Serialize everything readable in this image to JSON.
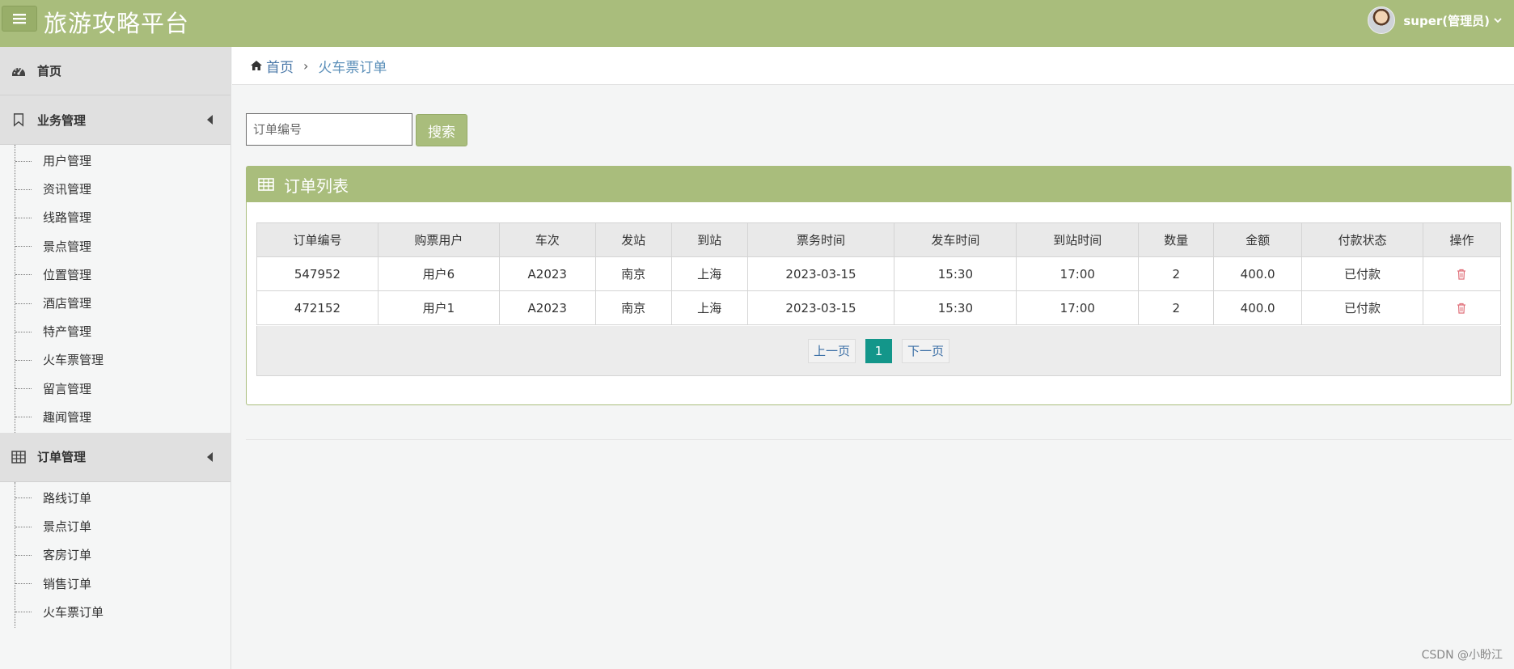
{
  "header": {
    "title": "旅游攻略平台",
    "user": "super(管理员)",
    "accent": "#a9bd7c"
  },
  "sidebar": {
    "home": "首页",
    "groups": [
      {
        "label": "业务管理",
        "items": [
          "用户管理",
          "资讯管理",
          "线路管理",
          "景点管理",
          "位置管理",
          "酒店管理",
          "特产管理",
          "火车票管理",
          "留言管理",
          "趣闻管理"
        ]
      },
      {
        "label": "订单管理",
        "items": [
          "路线订单",
          "景点订单",
          "客房订单",
          "销售订单",
          "火车票订单"
        ]
      }
    ]
  },
  "breadcrumb": {
    "home": "首页",
    "current": "火车票订单"
  },
  "search": {
    "placeholder": "订单编号",
    "button": "搜索"
  },
  "panel": {
    "title": "订单列表"
  },
  "table": {
    "columns": [
      "订单编号",
      "购票用户",
      "车次",
      "发站",
      "到站",
      "票务时间",
      "发车时间",
      "到站时间",
      "数量",
      "金额",
      "付款状态",
      "操作"
    ],
    "rows": [
      [
        "547952",
        "用户6",
        "A2023",
        "南京",
        "上海",
        "2023-03-15",
        "15:30",
        "17:00",
        "2",
        "400.0",
        "已付款"
      ],
      [
        "472152",
        "用户1",
        "A2023",
        "南京",
        "上海",
        "2023-03-15",
        "15:30",
        "17:00",
        "2",
        "400.0",
        "已付款"
      ]
    ]
  },
  "pagination": {
    "prev": "上一页",
    "page": "1",
    "next": "下一页"
  },
  "watermark": "CSDN @小盼江"
}
